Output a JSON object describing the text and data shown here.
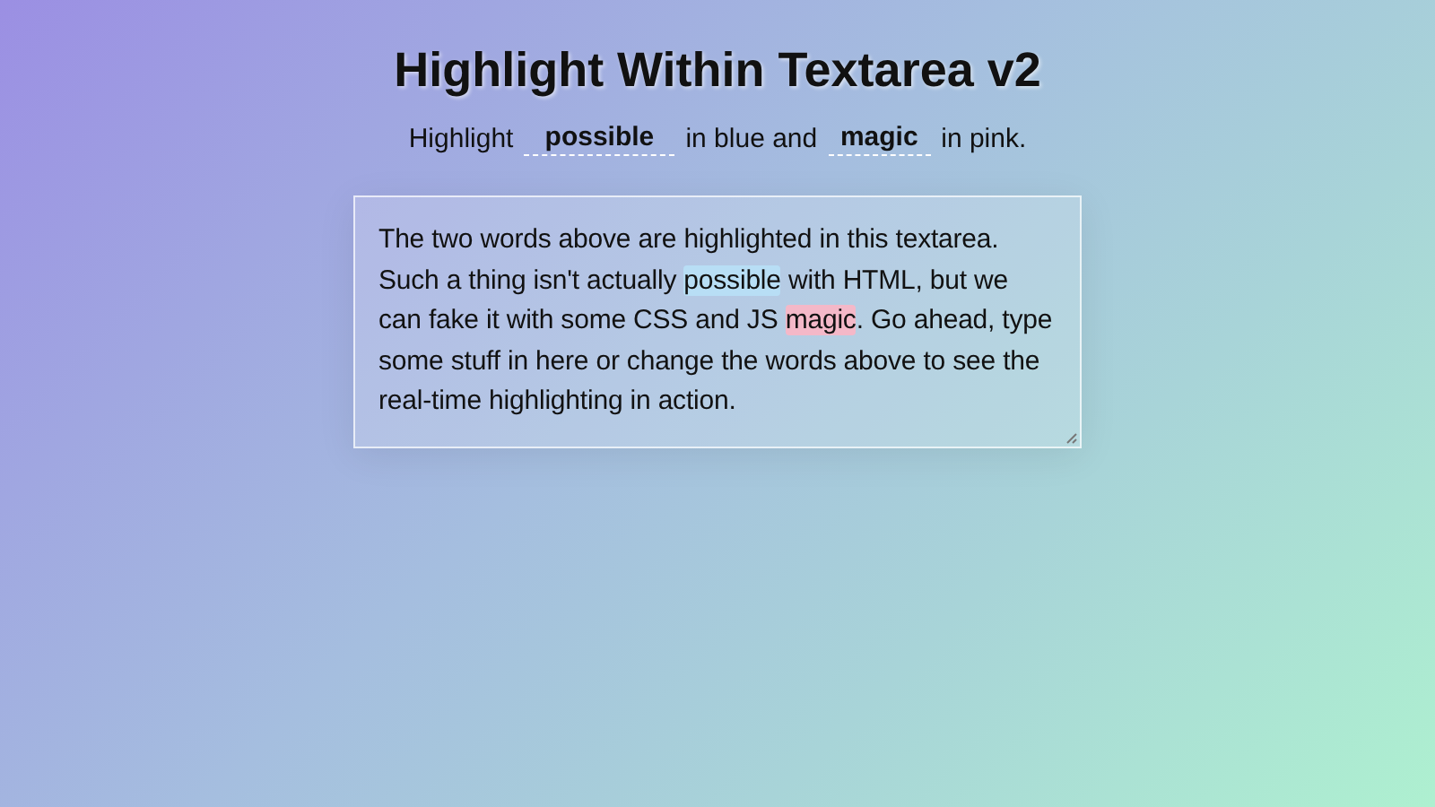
{
  "title": "Highlight Within Textarea v2",
  "subtitle": [
    {
      "kind": "text",
      "text": "Highlight"
    },
    {
      "kind": "input",
      "value": "possible"
    },
    {
      "kind": "text",
      "text": "in blue and"
    },
    {
      "kind": "input",
      "value": "magic"
    },
    {
      "kind": "text",
      "text": "in pink."
    }
  ],
  "textarea": [
    {
      "kind": "plain",
      "text": "The two words above are highlighted in this textarea. Such a thing isn't actually "
    },
    {
      "kind": "mark",
      "text": "possible",
      "color": "#b8def5"
    },
    {
      "kind": "plain",
      "text": " with HTML, but we can fake it with some CSS and JS "
    },
    {
      "kind": "mark",
      "text": "magic",
      "color": "#f4b8c8"
    },
    {
      "kind": "plain",
      "text": ". Go ahead, type some stuff in here or change the words above to see the real-time highlighting in action."
    }
  ]
}
